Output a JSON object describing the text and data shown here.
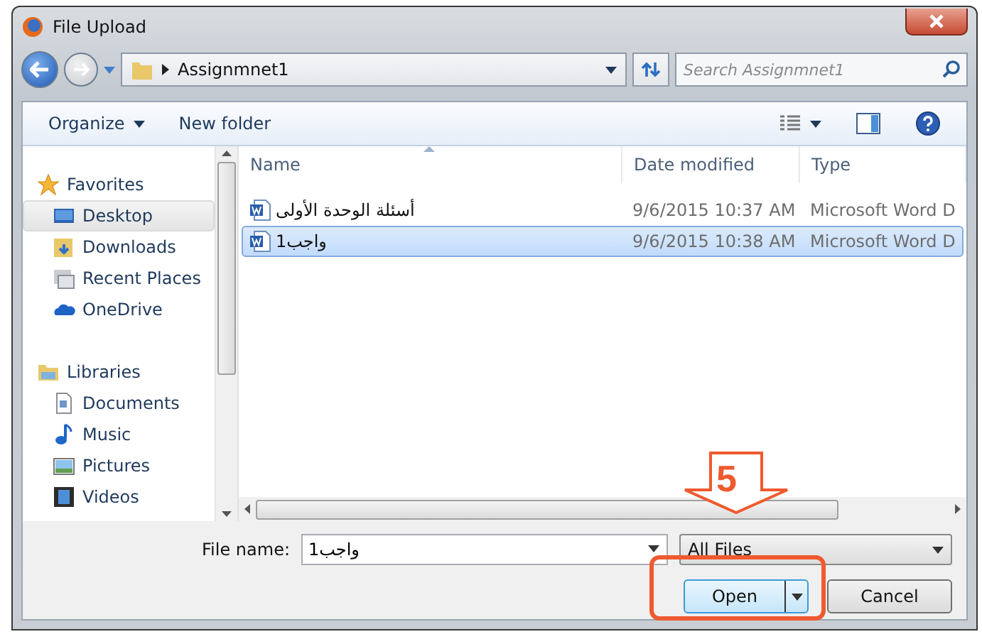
{
  "window": {
    "title": "File Upload"
  },
  "address": {
    "path": "Assignmnet1"
  },
  "search": {
    "placeholder": "Search Assignmnet1"
  },
  "toolbar": {
    "organize": "Organize",
    "new_folder": "New folder"
  },
  "sidebar": {
    "groups": [
      {
        "label": "Favorites",
        "kind": "favorites",
        "items": [
          {
            "label": "Desktop",
            "kind": "desktop",
            "selected": true
          },
          {
            "label": "Downloads",
            "kind": "downloads",
            "selected": false
          },
          {
            "label": "Recent Places",
            "kind": "recent",
            "selected": false
          },
          {
            "label": "OneDrive",
            "kind": "cloud",
            "selected": false
          }
        ]
      },
      {
        "label": "Libraries",
        "kind": "libraries",
        "items": [
          {
            "label": "Documents",
            "kind": "documents",
            "selected": false
          },
          {
            "label": "Music",
            "kind": "music",
            "selected": false
          },
          {
            "label": "Pictures",
            "kind": "pictures",
            "selected": false
          },
          {
            "label": "Videos",
            "kind": "videos",
            "selected": false
          }
        ]
      }
    ]
  },
  "file_list": {
    "columns": [
      "Name",
      "Date modified",
      "Type"
    ],
    "rows": [
      {
        "name": "أسئلة الوحدة الأولى",
        "date": "9/6/2015 10:37 AM",
        "type": "Microsoft Word D",
        "selected": false
      },
      {
        "name": "واجب1",
        "date": "9/6/2015 10:38 AM",
        "type": "Microsoft Word D",
        "selected": true
      }
    ]
  },
  "file_name": {
    "label": "File name:",
    "value": "واجب1"
  },
  "filter": {
    "value": "All Files"
  },
  "buttons": {
    "open": "Open",
    "cancel": "Cancel"
  },
  "annotation": {
    "step": "5"
  }
}
